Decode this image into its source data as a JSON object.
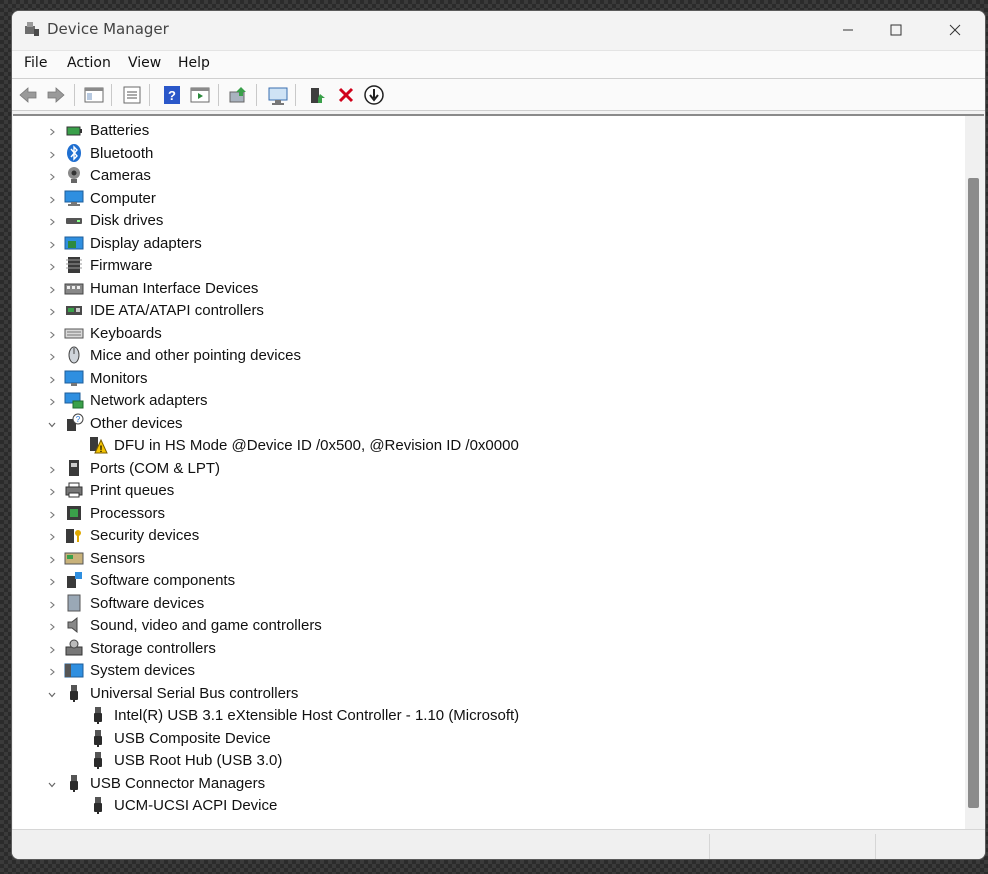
{
  "window": {
    "title": "Device Manager"
  },
  "menu": [
    "File",
    "Action",
    "View",
    "Help"
  ],
  "toolbar": {
    "buttons": [
      "back-icon",
      "forward-icon",
      "show-hide-console-tree-icon",
      "properties-icon",
      "help-icon",
      "action-pane-icon",
      "update-driver-icon",
      "scan-hardware-icon",
      "enable-device-icon",
      "uninstall-icon",
      "disable-device-icon"
    ]
  },
  "tree": [
    {
      "label": "Batteries",
      "icon": "battery-icon",
      "expanded": false,
      "level": 0
    },
    {
      "label": "Bluetooth",
      "icon": "bluetooth-icon",
      "expanded": false,
      "level": 0
    },
    {
      "label": "Cameras",
      "icon": "camera-icon",
      "expanded": false,
      "level": 0
    },
    {
      "label": "Computer",
      "icon": "computer-icon",
      "expanded": false,
      "level": 0
    },
    {
      "label": "Disk drives",
      "icon": "disk-drive-icon",
      "expanded": false,
      "level": 0
    },
    {
      "label": "Display adapters",
      "icon": "display-adapter-icon",
      "expanded": false,
      "level": 0
    },
    {
      "label": "Firmware",
      "icon": "firmware-icon",
      "expanded": false,
      "level": 0
    },
    {
      "label": "Human Interface Devices",
      "icon": "hid-icon",
      "expanded": false,
      "level": 0
    },
    {
      "label": "IDE ATA/ATAPI controllers",
      "icon": "ide-controller-icon",
      "expanded": false,
      "level": 0
    },
    {
      "label": "Keyboards",
      "icon": "keyboard-icon",
      "expanded": false,
      "level": 0
    },
    {
      "label": "Mice and other pointing devices",
      "icon": "mouse-icon",
      "expanded": false,
      "level": 0
    },
    {
      "label": "Monitors",
      "icon": "monitor-icon",
      "expanded": false,
      "level": 0
    },
    {
      "label": "Network adapters",
      "icon": "network-adapter-icon",
      "expanded": false,
      "level": 0
    },
    {
      "label": "Other devices",
      "icon": "unknown-device-icon",
      "expanded": true,
      "level": 0
    },
    {
      "label": "DFU in HS Mode @Device ID /0x500, @Revision ID /0x0000",
      "icon": "warning-device-icon",
      "level": 1
    },
    {
      "label": "Ports (COM & LPT)",
      "icon": "port-icon",
      "expanded": false,
      "level": 0
    },
    {
      "label": "Print queues",
      "icon": "printer-icon",
      "expanded": false,
      "level": 0
    },
    {
      "label": "Processors",
      "icon": "processor-icon",
      "expanded": false,
      "level": 0
    },
    {
      "label": "Security devices",
      "icon": "security-device-icon",
      "expanded": false,
      "level": 0
    },
    {
      "label": "Sensors",
      "icon": "sensor-icon",
      "expanded": false,
      "level": 0
    },
    {
      "label": "Software components",
      "icon": "software-component-icon",
      "expanded": false,
      "level": 0
    },
    {
      "label": "Software devices",
      "icon": "software-device-icon",
      "expanded": false,
      "level": 0
    },
    {
      "label": "Sound, video and game controllers",
      "icon": "speaker-icon",
      "expanded": false,
      "level": 0
    },
    {
      "label": "Storage controllers",
      "icon": "storage-controller-icon",
      "expanded": false,
      "level": 0
    },
    {
      "label": "System devices",
      "icon": "system-device-icon",
      "expanded": false,
      "level": 0
    },
    {
      "label": "Universal Serial Bus controllers",
      "icon": "usb-icon",
      "expanded": true,
      "level": 0
    },
    {
      "label": "Intel(R) USB 3.1 eXtensible Host Controller - 1.10 (Microsoft)",
      "icon": "usb-icon",
      "level": 1
    },
    {
      "label": "USB Composite Device",
      "icon": "usb-icon",
      "level": 1
    },
    {
      "label": "USB Root Hub (USB 3.0)",
      "icon": "usb-icon",
      "level": 1
    },
    {
      "label": "USB Connector Managers",
      "icon": "usb-icon",
      "expanded": true,
      "level": 0
    },
    {
      "label": "UCM-UCSI ACPI Device",
      "icon": "usb-icon",
      "level": 1
    }
  ]
}
